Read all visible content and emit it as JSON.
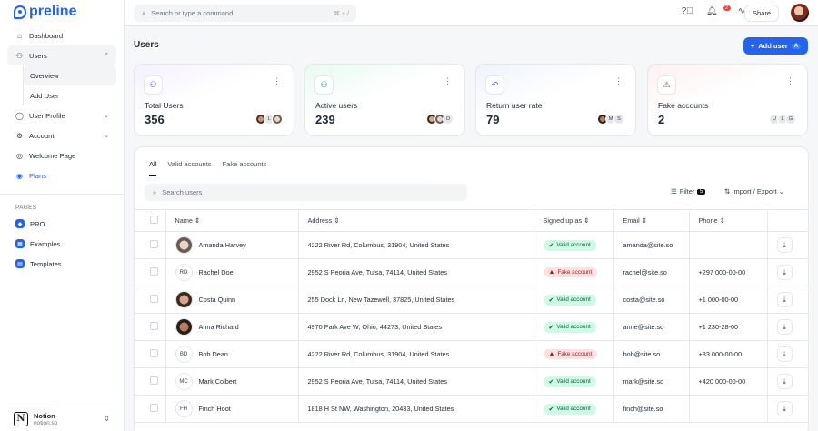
{
  "brand": {
    "name": "preline"
  },
  "sidebar": {
    "items": [
      {
        "label": "Dashboard",
        "icon": "home-icon"
      },
      {
        "label": "Users",
        "icon": "users-icon"
      },
      {
        "label": "Overview"
      },
      {
        "label": "Add User"
      },
      {
        "label": "User Profile",
        "icon": "user-icon"
      },
      {
        "label": "Account",
        "icon": "user-cog-icon"
      },
      {
        "label": "Welcome Page",
        "icon": "broadcast-icon"
      },
      {
        "label": "Plans",
        "icon": "coins-icon"
      }
    ],
    "pages_label": "PAGES",
    "pages": [
      {
        "label": "PRO"
      },
      {
        "label": "Examples"
      },
      {
        "label": "Templates"
      }
    ],
    "workspace": {
      "name": "Notion",
      "domain": "notion.so"
    }
  },
  "topbar": {
    "search_placeholder": "Search or type a command",
    "shortcut": "⌘ + /",
    "notif_count": "2",
    "share_label": "Share"
  },
  "page": {
    "title": "Users",
    "add_user_label": "Add user",
    "add_user_key": "A"
  },
  "stats": [
    {
      "label": "Total Users",
      "value": "356",
      "avatars": [
        "",
        "L",
        ""
      ]
    },
    {
      "label": "Active users",
      "value": "239",
      "avatars": [
        "",
        "",
        "O"
      ]
    },
    {
      "label": "Return user rate",
      "value": "79",
      "avatars": [
        "",
        "M",
        "S"
      ]
    },
    {
      "label": "Fake accounts",
      "value": "2",
      "avatars": [
        "U",
        "L",
        "G"
      ]
    }
  ],
  "tabs": [
    "All",
    "Valid accounts",
    "Fake accounts"
  ],
  "table": {
    "search_placeholder": "Search users",
    "filter_label": "Filter",
    "filter_count": "5",
    "import_export_label": "Import / Export",
    "columns": [
      "Name",
      "Address",
      "Signed up as",
      "Email",
      "Phone"
    ],
    "rows": [
      {
        "initials": "",
        "name": "Amanda Harvey",
        "address": "4222 River Rd, Columbus, 31904, United States",
        "status": "Valid account",
        "kind": "valid",
        "email": "amanda@site.so",
        "phone": ""
      },
      {
        "initials": "RD",
        "name": "Rachel Doe",
        "address": "2952 S Peoria Ave, Tulsa, 74114, United States",
        "status": "Fake account",
        "kind": "fake",
        "email": "rachel@site.so",
        "phone": "+297 000-00-00"
      },
      {
        "initials": "",
        "name": "Costa Quinn",
        "address": "255 Dock Ln, New Tazewell, 37825, United States",
        "status": "Valid account",
        "kind": "valid",
        "email": "costa@site.so",
        "phone": "+1 000-00-00"
      },
      {
        "initials": "",
        "name": "Anna Richard",
        "address": "4970 Park Ave W, Ohio, 44273, United States",
        "status": "Valid account",
        "kind": "valid",
        "email": "anne@site.so",
        "phone": "+1 230-28-00"
      },
      {
        "initials": "BD",
        "name": "Bob Dean",
        "address": "4222 River Rd, Columbus, 31904, United States",
        "status": "Fake account",
        "kind": "fake",
        "email": "bob@site.so",
        "phone": "+33 000-00-00"
      },
      {
        "initials": "MC",
        "name": "Mark Colbert",
        "address": "2952 S Peoria Ave, Tulsa, 74114, United States",
        "status": "Valid account",
        "kind": "valid",
        "email": "mark@site.so",
        "phone": "+420 000-00-00"
      },
      {
        "initials": "FH",
        "name": "Finch Hoot",
        "address": "1818 H St NW, Washington, 20433, United States",
        "status": "Valid account",
        "kind": "valid",
        "email": "finch@site.so",
        "phone": ""
      }
    ]
  }
}
